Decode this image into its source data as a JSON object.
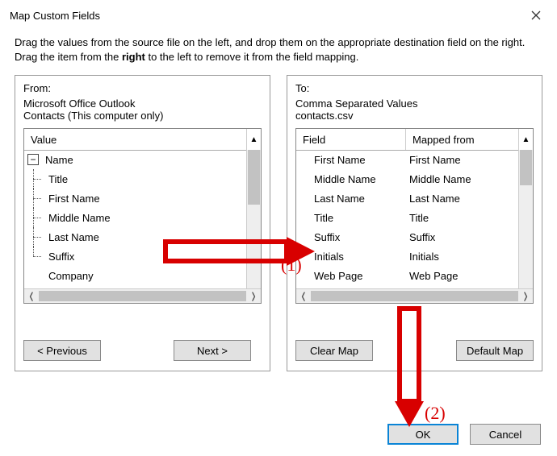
{
  "window": {
    "title": "Map Custom Fields",
    "instructions_parts": {
      "p1": "Drag the values from the source file on the left, and drop them on the appropriate destination field on the right.  Drag the item from the ",
      "bold": "right",
      "p2": " to the left to remove it from the field mapping."
    }
  },
  "from": {
    "label": "From:",
    "line1": "Microsoft Office Outlook",
    "line2": "Contacts (This computer only)",
    "header": "Value",
    "tree": {
      "root": "Name",
      "children": [
        "Title",
        "First Name",
        "Middle Name",
        "Last Name",
        "Suffix"
      ],
      "after": "Company"
    },
    "buttons": {
      "prev": "< Previous",
      "next": "Next >"
    }
  },
  "to": {
    "label": "To:",
    "line1": "Comma Separated Values",
    "line2": "contacts.csv",
    "headers": {
      "field": "Field",
      "mapped": "Mapped from"
    },
    "rows": [
      {
        "field": "First Name",
        "mapped": "First Name"
      },
      {
        "field": "Middle Name",
        "mapped": "Middle Name"
      },
      {
        "field": "Last Name",
        "mapped": "Last Name"
      },
      {
        "field": "Title",
        "mapped": "Title"
      },
      {
        "field": "Suffix",
        "mapped": "Suffix"
      },
      {
        "field": "Initials",
        "mapped": "Initials"
      },
      {
        "field": "Web Page",
        "mapped": "Web Page"
      }
    ],
    "buttons": {
      "clear": "Clear Map",
      "default": "Default Map"
    }
  },
  "dialog_buttons": {
    "ok": "OK",
    "cancel": "Cancel"
  },
  "annotations": {
    "one": "(1)",
    "two": "(2)"
  }
}
